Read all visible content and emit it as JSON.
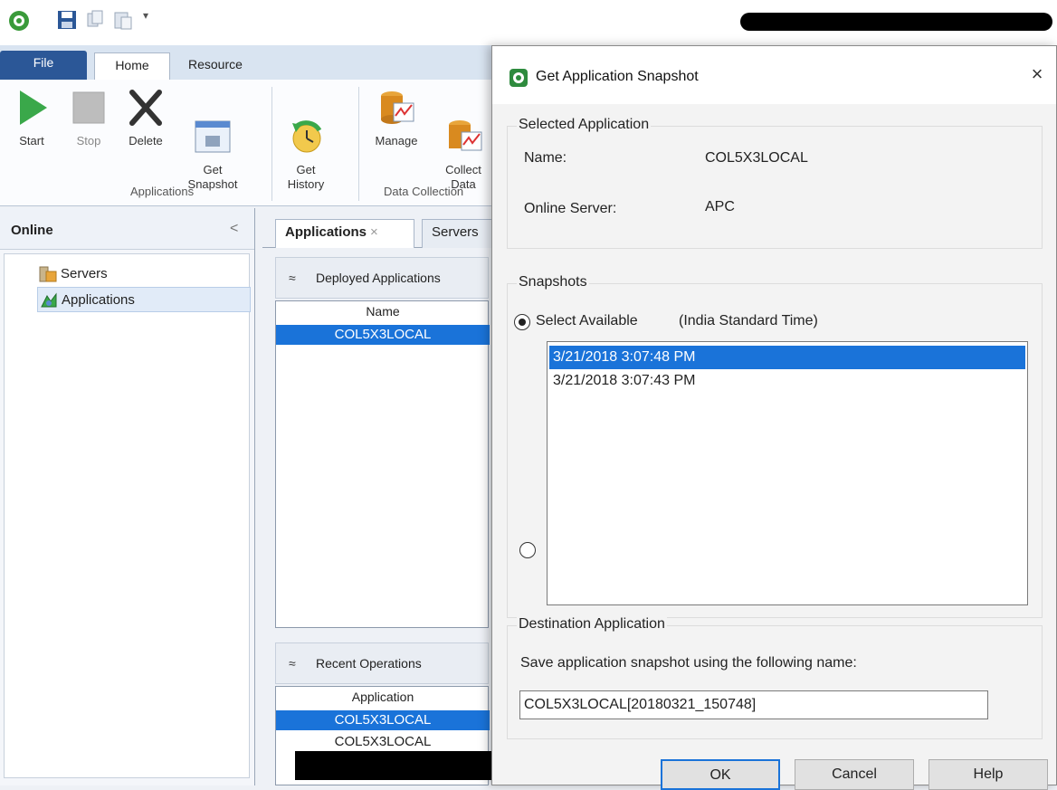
{
  "app": {
    "quick_access": [
      "app-logo-icon",
      "save-icon",
      "copy-icon",
      "paste-icon",
      "dropdown-icon"
    ]
  },
  "ribbon": {
    "tabs": [
      {
        "label": "File"
      },
      {
        "label": "Home"
      },
      {
        "label": "Resource"
      }
    ],
    "buttons": [
      {
        "label": "Start",
        "icon": "play-icon"
      },
      {
        "label": "Stop",
        "icon": "stop-icon"
      },
      {
        "label": "Delete",
        "icon": "delete-icon"
      },
      {
        "label": "Get\nSnapshot",
        "icon": "snapshot-icon"
      },
      {
        "label": "Get\nHistory",
        "icon": "history-icon"
      },
      {
        "label": "Manage",
        "icon": "manage-icon"
      },
      {
        "label": "Collect\nData",
        "icon": "collect-data-icon"
      }
    ],
    "groups": [
      {
        "label": "Applications"
      },
      {
        "label": "Data Collection"
      }
    ]
  },
  "left_panel": {
    "title": "Online",
    "collapse": "<",
    "tree": [
      {
        "label": "Servers",
        "icon": "servers-icon"
      },
      {
        "label": "Applications",
        "icon": "applications-icon"
      }
    ]
  },
  "center": {
    "tabs": [
      {
        "label": "Applications",
        "close": "×"
      },
      {
        "label": "Servers"
      }
    ],
    "deployed": {
      "header": "Deployed Applications",
      "chevron": "≈",
      "column": "Name",
      "rows": [
        "COL5X3LOCAL"
      ]
    },
    "recent": {
      "header": "Recent Operations",
      "chevron": "≈",
      "column": "Application",
      "rows": [
        "COL5X3LOCAL",
        "COL5X3LOCAL"
      ]
    }
  },
  "dialog": {
    "title": "Get Application Snapshot",
    "close": "×",
    "selected_app": {
      "legend": "Selected Application",
      "name_label": "Name:",
      "name_value": "COL5X3LOCAL",
      "server_label": "Online Server:",
      "server_value": "APC"
    },
    "snapshots": {
      "legend": "Snapshots",
      "option_available": "Select Available",
      "timezone": "(India Standard Time)",
      "items": [
        "3/21/2018 3:07:48 PM",
        "3/21/2018 3:07:43 PM"
      ]
    },
    "destination": {
      "legend": "Destination Application",
      "prompt": "Save application snapshot using the following name:",
      "value": "COL5X3LOCAL[20180321_150748]"
    },
    "buttons": {
      "ok": "OK",
      "cancel": "Cancel",
      "help": "Help"
    }
  }
}
